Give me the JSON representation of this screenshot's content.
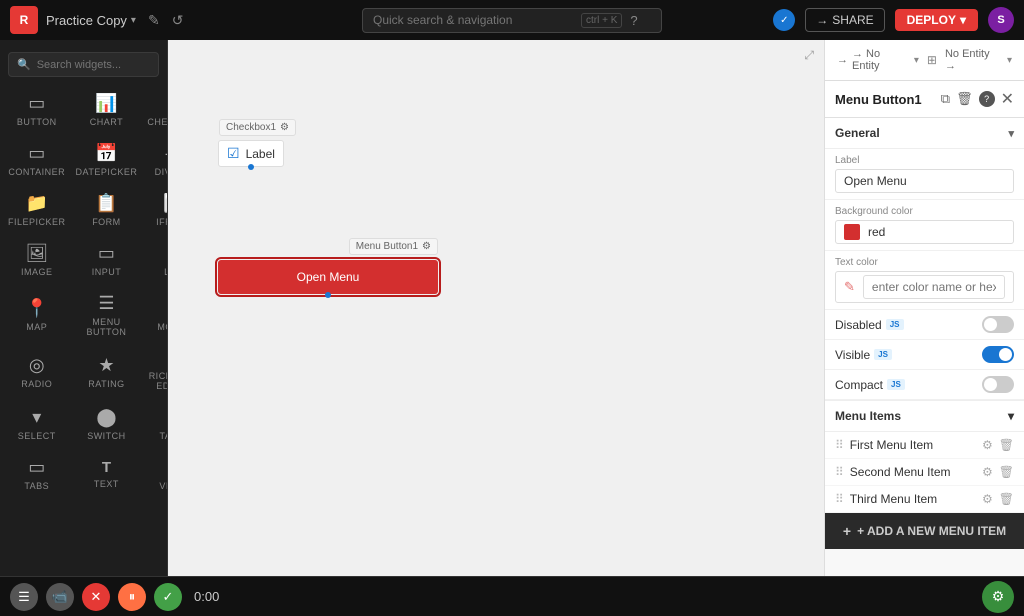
{
  "topbar": {
    "logo_text": "R",
    "project_name": "Practice Copy",
    "pencil_icon": "✎",
    "history_icon": "↺",
    "search_placeholder": "Quick search & navigation",
    "search_shortcut": "ctrl + K",
    "help_icon": "?",
    "verified_icon": "✓",
    "share_label": "SHARE",
    "deploy_label": "DEPLOY",
    "deploy_arrow": "▾",
    "avatar_label": "S"
  },
  "sidebar": {
    "search_placeholder": "Search widgets...",
    "widgets": [
      {
        "icon": "▭",
        "label": "BUTTON"
      },
      {
        "icon": "📊",
        "label": "CHART"
      },
      {
        "icon": "☑",
        "label": "CHECKBOX"
      },
      {
        "icon": "▭",
        "label": "CONTAINER"
      },
      {
        "icon": "📅",
        "label": "DATEPICKER"
      },
      {
        "icon": "—",
        "label": "DIVIDER"
      },
      {
        "icon": "📁",
        "label": "FILEPICKER"
      },
      {
        "icon": "📋",
        "label": "FORM"
      },
      {
        "icon": "⬜",
        "label": "IFRAME"
      },
      {
        "icon": "🖼",
        "label": "IMAGE"
      },
      {
        "icon": "▭",
        "label": "INPUT"
      },
      {
        "icon": "≡",
        "label": "LIST",
        "beta": true
      },
      {
        "icon": "📍",
        "label": "MAP"
      },
      {
        "icon": "☰",
        "label": "MENU BUTTON"
      },
      {
        "icon": "◻",
        "label": "MODAL"
      },
      {
        "icon": "◎",
        "label": "RADIO"
      },
      {
        "icon": "★",
        "label": "RATING"
      },
      {
        "icon": "T",
        "label": "RICH TEXT EDITOR"
      },
      {
        "icon": "▾",
        "label": "SELECT"
      },
      {
        "icon": "⬤",
        "label": "SWITCH"
      },
      {
        "icon": "▦",
        "label": "TABLE"
      },
      {
        "icon": "▭",
        "label": "TABS"
      },
      {
        "icon": "T",
        "label": "TEXT"
      },
      {
        "icon": "▷",
        "label": "VIDEO"
      }
    ]
  },
  "canvas": {
    "checkbox_label": "Checkbox1",
    "checkbox_gear": "⚙",
    "checkbox_text": "Label",
    "menubutton_label": "Menu Button1",
    "menubutton_gear": "⚙",
    "menubutton_text": "Open Menu"
  },
  "panel": {
    "entity_left": "→ No Entity",
    "entity_right": "No Entity →",
    "entity_grid_icon": "⊞",
    "title": "Menu Button1",
    "copy_icon": "⧉",
    "delete_icon": "🗑",
    "help_icon": "?",
    "close_icon": "✕",
    "general_section": "General",
    "general_chevron": "▾",
    "label_field": "Label",
    "label_value": "Open Menu",
    "bg_color_label": "Background color",
    "bg_color_value": "red",
    "text_color_label": "Text color",
    "text_color_placeholder": "enter color name or hex",
    "disabled_label": "Disabled",
    "disabled_js": "JS",
    "visible_label": "Visible",
    "visible_js": "JS",
    "compact_label": "Compact",
    "compact_js": "JS",
    "menu_items_section": "Menu Items",
    "menu_items_chevron": "▾",
    "menu_items": [
      {
        "label": "First Menu Item"
      },
      {
        "label": "Second Menu Item"
      },
      {
        "label": "Third Menu Item"
      }
    ],
    "add_menu_item_label": "+ ADD A NEW MENU ITEM"
  },
  "bottom_bar": {
    "timer": "0:00"
  }
}
